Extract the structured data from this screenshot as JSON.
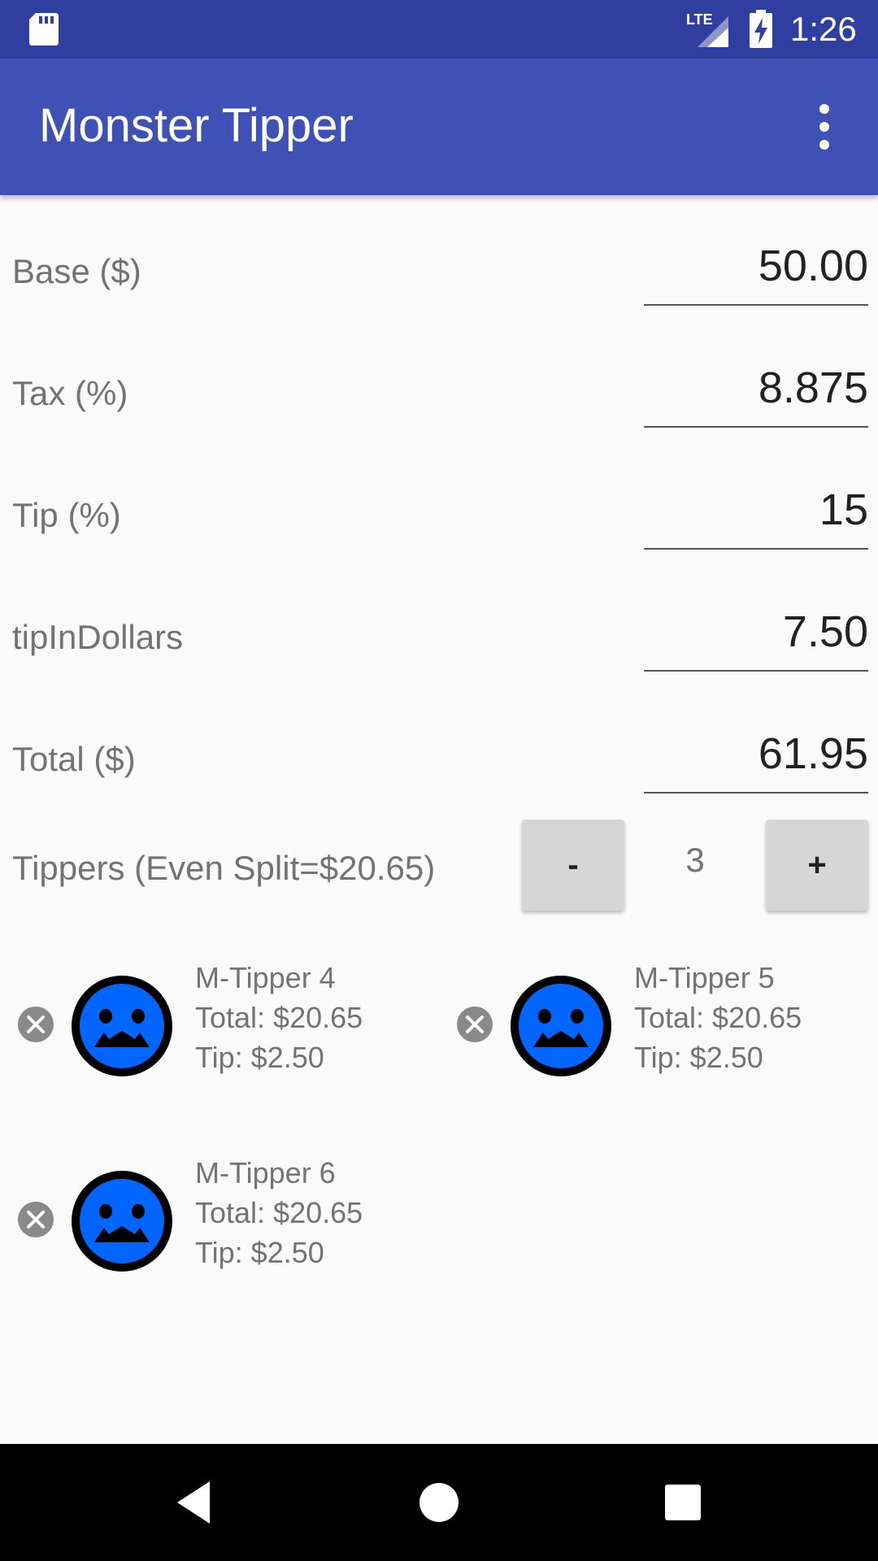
{
  "status_bar": {
    "time": "1:26",
    "network": "LTE",
    "icons": [
      "sd-card-icon",
      "lte-signal-icon",
      "battery-charging-icon"
    ]
  },
  "app_bar": {
    "title": "Monster Tipper",
    "menu_icon": "more-vert-icon"
  },
  "fields": {
    "base": {
      "label": "Base ($)",
      "value": "50.00"
    },
    "tax": {
      "label": "Tax (%)",
      "value": "8.875"
    },
    "tip": {
      "label": "Tip (%)",
      "value": "15"
    },
    "tip_dollars": {
      "label": "tipInDollars",
      "value": "7.50"
    },
    "total": {
      "label": "Total ($)",
      "value": "61.95"
    }
  },
  "tippers": {
    "label": "Tippers (Even Split=$20.65)",
    "minus_label": "-",
    "plus_label": "+",
    "count": "3",
    "list": [
      {
        "name": "M-Tipper 4",
        "total": "Total: $20.65",
        "tip": "Tip: $2.50"
      },
      {
        "name": "M-Tipper 5",
        "total": "Total: $20.65",
        "tip": "Tip: $2.50"
      },
      {
        "name": "M-Tipper 6",
        "total": "Total: $20.65",
        "tip": "Tip: $2.50"
      }
    ]
  },
  "colors": {
    "status_bar": "#303f9f",
    "app_bar": "#3f51b5",
    "face": "#0066ff"
  },
  "nav_bar": {
    "icons": [
      "back-icon",
      "home-icon",
      "recents-icon"
    ]
  }
}
